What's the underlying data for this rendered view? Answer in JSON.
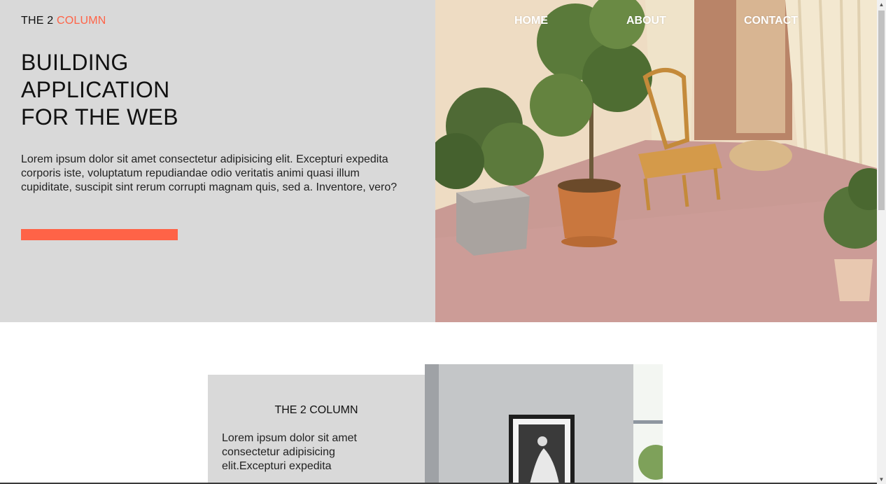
{
  "brand": {
    "prefix": "THE 2",
    "accent": "COLUMN",
    "accent_color": "#ff6347"
  },
  "nav": {
    "home": "HOME",
    "about": "ABOUT",
    "contact": "CONTACT"
  },
  "hero": {
    "title_lines": [
      "BUILDING",
      "APPLICATION",
      "FOR THE WEB"
    ],
    "paragraph": "Lorem ipsum dolor sit amet consectetur adipisicing elit. Excepturi expedita corporis iste, voluptatum repudiandae odio veritatis animi quasi illum cupiditate, suscipit sint rerum corrupti magnam quis, sed a. Inventore, vero?",
    "button_color": "#ff6347",
    "panel_color": "#d9d9d9"
  },
  "section": {
    "title": "THE 2 COLUMN",
    "text": "Lorem ipsum dolor sit amet consectetur adipisicing elit.Excepturi expedita"
  },
  "icons": {
    "scroll_up": "triangle-up",
    "scroll_down": "triangle-down"
  }
}
